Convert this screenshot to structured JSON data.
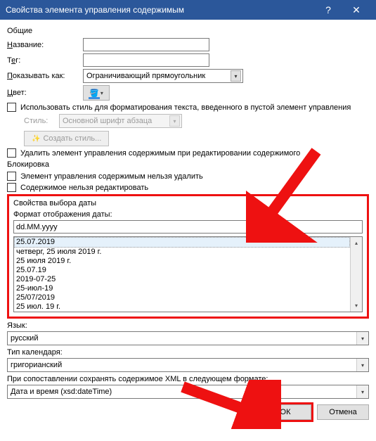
{
  "title": "Свойства элемента управления содержимым",
  "sections": {
    "general": "Общие",
    "lock": "Блокировка",
    "date_props": "Свойства выбора даты"
  },
  "labels": {
    "name": "Название:",
    "tag": "Тег:",
    "show_as": "Показывать как:",
    "color": "Цвет:",
    "use_style": "Использовать стиль для форматирования текста, введенного в пустой элемент управления",
    "style": "Стиль:",
    "new_style": "Создать стиль...",
    "remove_on_edit": "Удалить элемент управления содержимым при редактировании содержимого",
    "lock_delete": "Элемент управления содержимым нельзя удалить",
    "lock_edit": "Содержимое нельзя редактировать",
    "date_format": "Формат отображения даты:",
    "locale": "Язык:",
    "calendar": "Тип календаря:",
    "xml_store": "При сопоставлении сохранять содержимое XML в следующем формате:"
  },
  "values": {
    "name": "",
    "tag": "",
    "show_as": "Ограничивающий прямоугольник",
    "style": "Основной шрифт абзаца",
    "date_format": "dd.MM.yyyy",
    "locale": "русский",
    "calendar": "григорианский",
    "xml_store": "Дата и время (xsd:dateTime)"
  },
  "date_examples": [
    "25.07.2019",
    "четверг, 25 июля 2019 г.",
    "25 июля 2019 г.",
    "25.07.19",
    "2019-07-25",
    "25-июл-19",
    "25/07/2019",
    "25 июл. 19 г."
  ],
  "buttons": {
    "ok": "ОК",
    "cancel": "Отмена"
  }
}
